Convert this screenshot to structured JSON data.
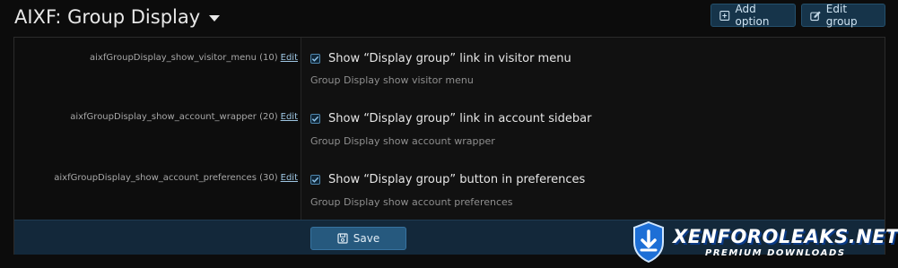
{
  "header": {
    "title": "AIXF: Group Display",
    "add_option_label": "Add option",
    "edit_group_label": "Edit group"
  },
  "options": [
    {
      "key_label": "aixfGroupDisplay_show_visitor_menu (10)",
      "edit_label": "Edit",
      "title": "Show “Display group” link in visitor menu",
      "description": "Group Display show visitor menu",
      "checked": true
    },
    {
      "key_label": "aixfGroupDisplay_show_account_wrapper (20)",
      "edit_label": "Edit",
      "title": "Show “Display group” link in account sidebar",
      "description": "Group Display show account wrapper",
      "checked": true
    },
    {
      "key_label": "aixfGroupDisplay_show_account_preferences (30)",
      "edit_label": "Edit",
      "title": "Show “Display group” button in preferences",
      "description": "Group Display show account preferences",
      "checked": true
    }
  ],
  "footer": {
    "save_label": "Save"
  },
  "watermark": {
    "name": "XENFOROLEAKS.NET",
    "tagline": "PREMIUM DOWNLOADS"
  }
}
